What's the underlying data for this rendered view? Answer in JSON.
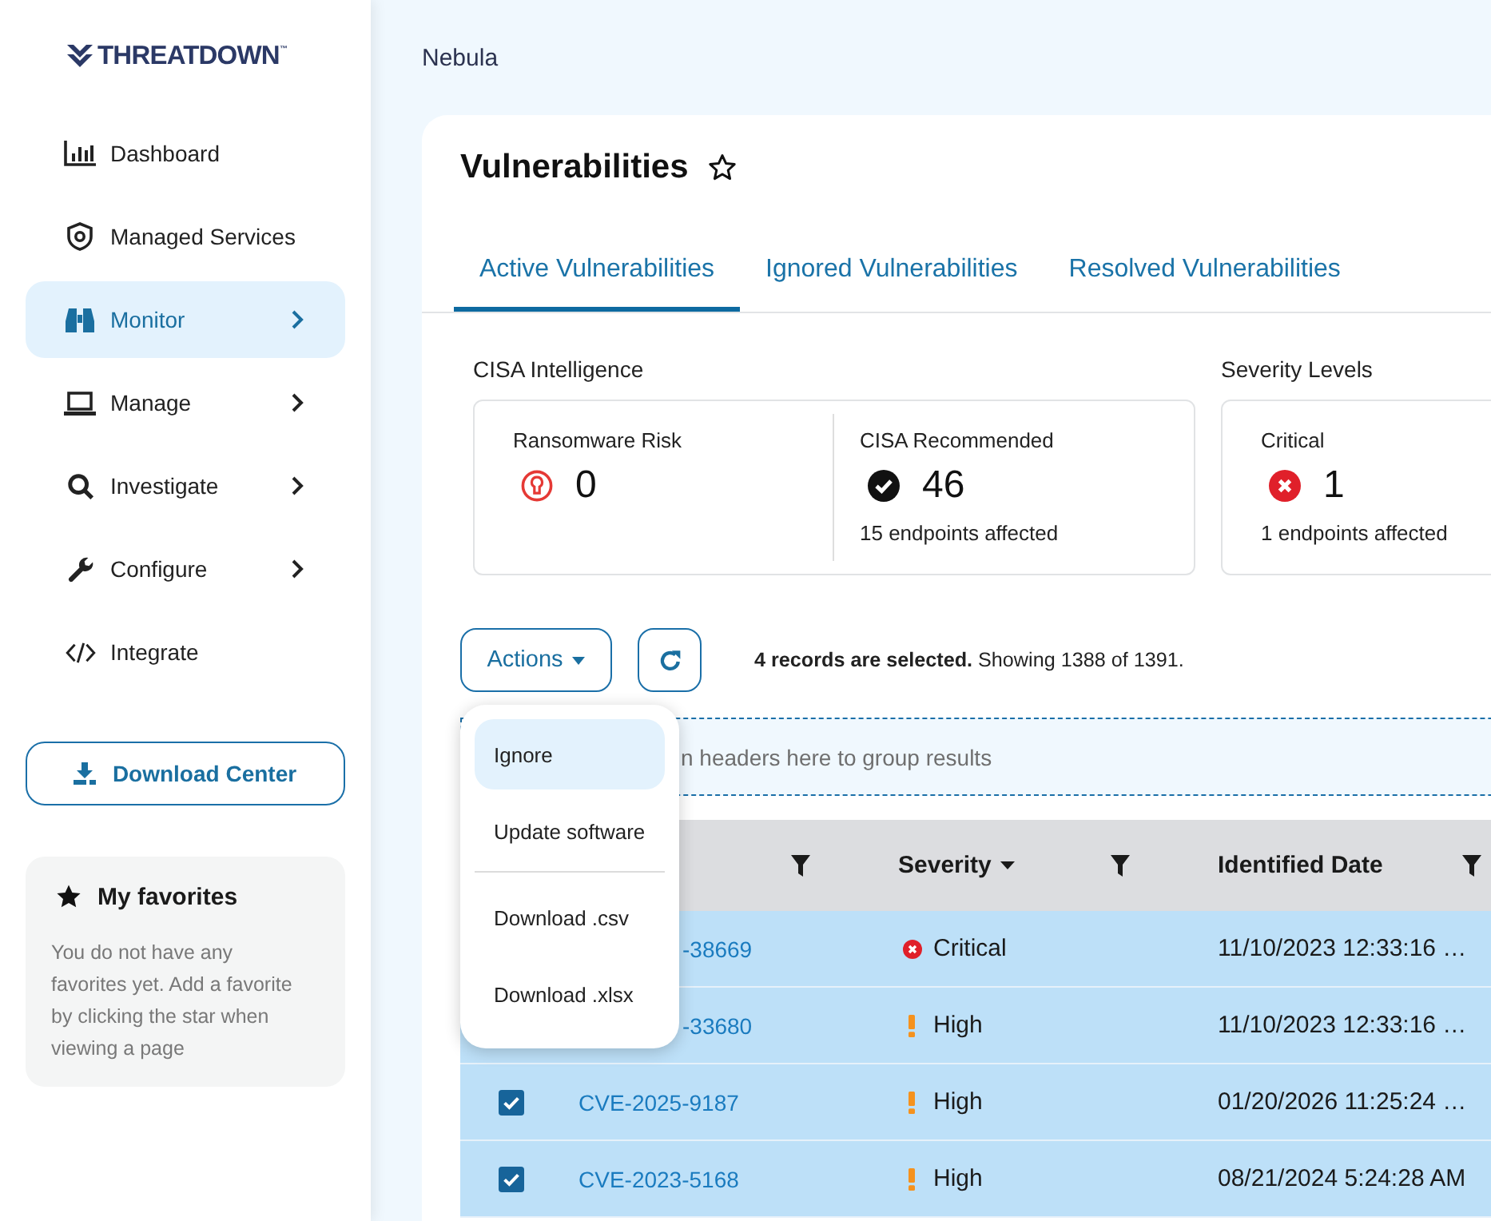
{
  "sidebar": {
    "logo": "THREATDOWN$^{™}$",
    "nav": [
      {
        "label": "Dashboard",
        "selected": false,
        "submenu": false
      },
      {
        "label": "Managed Services",
        "selected": false,
        "submenu": false
      },
      {
        "label": "Monitor",
        "selected": true,
        "submenu": true
      },
      {
        "label": "Manage",
        "selected": false,
        "submenu": true
      },
      {
        "label": "Investigate",
        "selected": false,
        "submenu": true
      },
      {
        "label": "Configure",
        "selected": false,
        "submenu": true
      },
      {
        "label": "Integrate",
        "selected": false,
        "submenu": false
      }
    ],
    "download_button": "Download Center",
    "favorites": {
      "title": "My favorites",
      "text": "You do not have any favorites yet. Add a favorite by clicking the star when viewing a page"
    }
  },
  "breadcrumb": "Nebula",
  "page": {
    "title": "Vulnerabilities",
    "favorited": false
  },
  "tabs": [
    {
      "label": "Active Vulnerabilities",
      "selected": true
    },
    {
      "label": "Ignored Vulnerabilities",
      "selected": false
    },
    {
      "label": "Resolved Vulnerabilities",
      "selected": false
    }
  ],
  "stat_groups": [
    {
      "title": "CISA Intelligence",
      "stats": [
        {
          "label": "Ransomware Risk",
          "value": "0"
        },
        {
          "label": "CISA Recommended",
          "value": "46",
          "note": "15 endpoints affected"
        }
      ]
    },
    {
      "title": "Severity Levels",
      "stats": [
        {
          "label": "Critical",
          "value": "1",
          "note": "1 endpoints affected"
        }
      ]
    }
  ],
  "toolbar": {
    "actions_button": "Actions",
    "summary": "**4 records are selected.** Showing 1388 of 1391."
  },
  "actions_menu": {
    "open": true,
    "groups": [
      {
        "items": [
          {
            "label": "Ignore",
            "selected": true
          },
          {
            "label": "Update software",
            "selected": false
          }
        ]
      },
      {
        "items": [
          {
            "label": "Download .csv",
            "selected": false
          },
          {
            "label": "Download .xlsx",
            "selected": false
          }
        ]
      }
    ]
  },
  "group_zone": {
    "hint": "n headers here to group results"
  },
  "table": {
    "columns": [
      {
        "filter": true
      },
      {
        "label": "Severity",
        "sort_descending": true,
        "filter": true
      },
      {
        "label": "Identified Date",
        "filter": true
      }
    ],
    "rows": [
      {
        "selected": true,
        "cve": "-38669",
        "severity": {
          "label": "Critical",
          "kind": "critical"
        },
        "identified_date": "11/10/2023 12:33:16 …"
      },
      {
        "selected": true,
        "cve": "-33680",
        "severity": {
          "label": "High",
          "kind": "high"
        },
        "identified_date": "11/10/2023 12:33:16 …"
      },
      {
        "selected": true,
        "checked": true,
        "cve": "CVE-2025-9187",
        "severity": {
          "label": "High",
          "kind": "high"
        },
        "identified_date": "01/20/2026 11:25:24 …"
      },
      {
        "selected": true,
        "checked": true,
        "cve": "CVE-2023-5168",
        "severity": {
          "label": "High",
          "kind": "high"
        },
        "identified_date": "08/21/2024 5:24:28 AM"
      }
    ]
  }
}
